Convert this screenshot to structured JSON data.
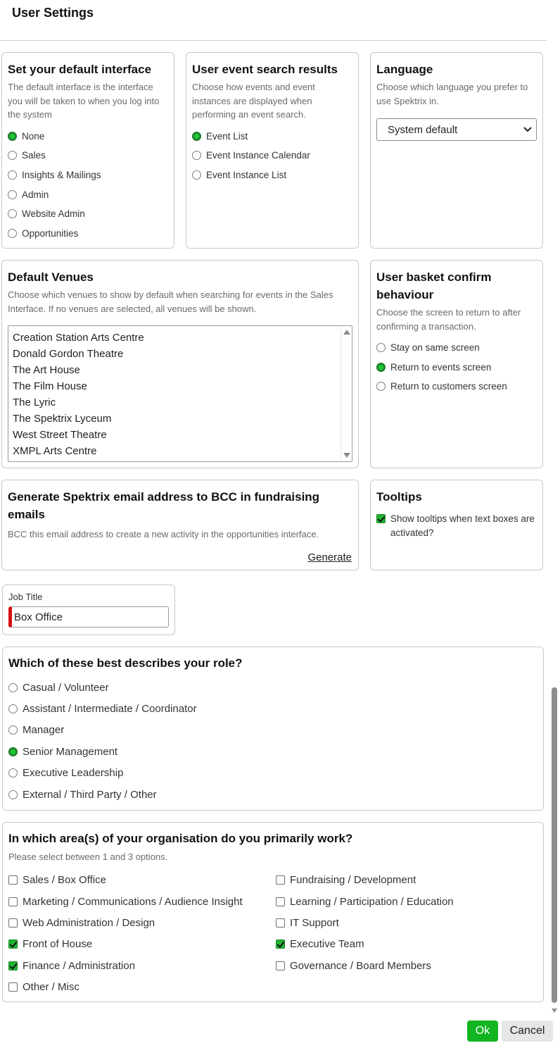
{
  "page": {
    "title": "User Settings"
  },
  "default_interface": {
    "title": "Set your default interface",
    "description": "The default interface is the interface you will be taken to when you log into the system",
    "options": [
      {
        "label": "None",
        "selected": true
      },
      {
        "label": "Sales",
        "selected": false
      },
      {
        "label": "Insights & Mailings",
        "selected": false
      },
      {
        "label": "Admin",
        "selected": false
      },
      {
        "label": "Website Admin",
        "selected": false
      },
      {
        "label": "Opportunities",
        "selected": false
      }
    ]
  },
  "event_search": {
    "title": "User event search results",
    "description": "Choose how events and event instances are displayed when performing an event search.",
    "options": [
      {
        "label": "Event List",
        "selected": true
      },
      {
        "label": "Event Instance Calendar",
        "selected": false
      },
      {
        "label": "Event Instance List",
        "selected": false
      }
    ]
  },
  "language": {
    "title": "Language",
    "description": "Choose which language you prefer to use Spektrix in.",
    "selected": "System default"
  },
  "venues": {
    "title": "Default Venues",
    "description": "Choose which venues to show by default when searching for events in the Sales Interface. If no venues are selected, all venues will be shown.",
    "items": [
      "Creation Station Arts Centre",
      "Donald Gordon Theatre",
      "The Art House",
      "The Film House",
      "The Lyric",
      "The Spektrix Lyceum",
      "West Street Theatre",
      "XMPL Arts Centre"
    ]
  },
  "basket": {
    "title": "User basket confirm behaviour",
    "description": "Choose the screen to return to after confirming a transaction.",
    "options": [
      {
        "label": "Stay on same screen",
        "selected": false
      },
      {
        "label": "Return to events screen",
        "selected": true
      },
      {
        "label": "Return to customers screen",
        "selected": false
      }
    ]
  },
  "bcc": {
    "title": "Generate Spektrix email address to BCC in fundraising emails",
    "description": "BCC this email address to create a new activity in the opportunities interface.",
    "action": "Generate"
  },
  "tooltips": {
    "title": "Tooltips",
    "option": {
      "label": "Show tooltips when text boxes are activated?",
      "checked": true
    }
  },
  "job": {
    "label": "Job Title",
    "value": "Box Office"
  },
  "role": {
    "title": "Which of these best describes your role?",
    "options": [
      {
        "label": "Casual / Volunteer",
        "selected": false
      },
      {
        "label": "Assistant / Intermediate / Coordinator",
        "selected": false
      },
      {
        "label": "Manager",
        "selected": false
      },
      {
        "label": "Senior Management",
        "selected": true
      },
      {
        "label": "Executive Leadership",
        "selected": false
      },
      {
        "label": "External / Third Party / Other",
        "selected": false
      }
    ]
  },
  "areas": {
    "title": "In which area(s) of your organisation do you primarily work?",
    "description": "Please select between 1 and 3 options.",
    "options": [
      {
        "label": "Sales / Box Office",
        "checked": false
      },
      {
        "label": "Fundraising / Development",
        "checked": false
      },
      {
        "label": "Marketing / Communications / Audience Insight",
        "checked": false
      },
      {
        "label": "Learning / Participation / Education",
        "checked": false
      },
      {
        "label": "Web Administration / Design",
        "checked": false
      },
      {
        "label": "IT Support",
        "checked": false
      },
      {
        "label": "Front of House",
        "checked": true
      },
      {
        "label": "Executive Team",
        "checked": true
      },
      {
        "label": "Finance / Administration",
        "checked": true
      },
      {
        "label": "Governance / Board Members",
        "checked": false
      },
      {
        "label": "Other / Misc",
        "checked": false
      }
    ]
  },
  "footer": {
    "ok": "Ok",
    "cancel": "Cancel"
  },
  "colors": {
    "accent": "#1fb532",
    "ok_button": "#12b521",
    "required_marker": "#d80f0f"
  }
}
